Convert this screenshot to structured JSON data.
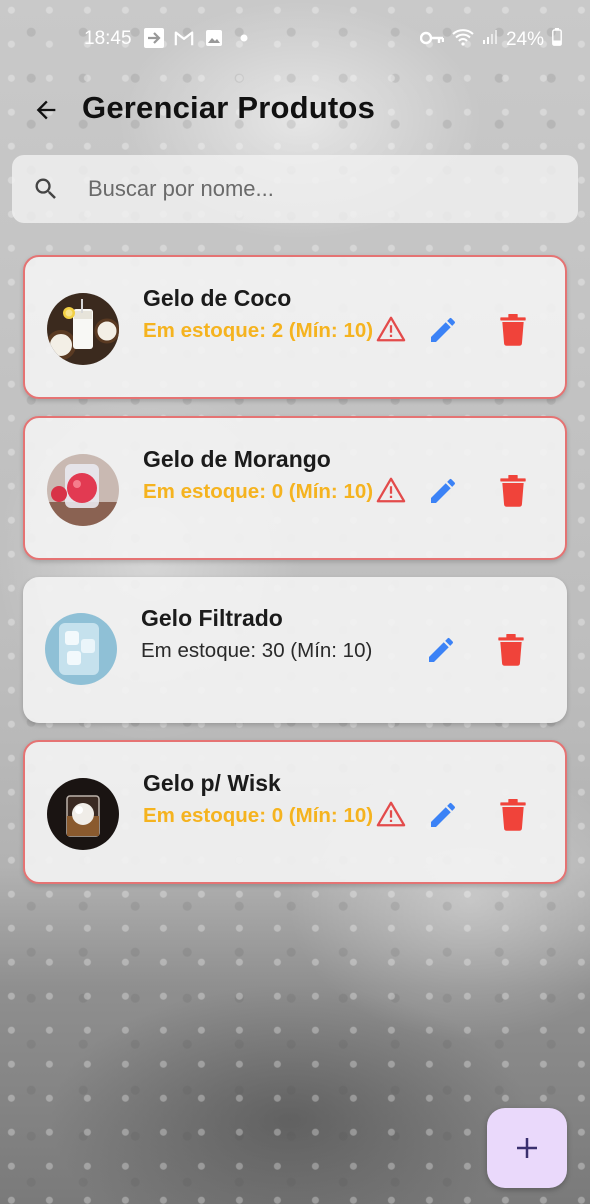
{
  "status_bar": {
    "time": "18:45",
    "battery": "24%",
    "left_icons": [
      "forward-icon",
      "gmail-icon",
      "image-icon",
      "dot-icon"
    ],
    "right_icons": [
      "key-icon",
      "wifi-icon",
      "signal-icon",
      "battery-icon"
    ]
  },
  "header": {
    "title": "Gerenciar Produtos"
  },
  "search": {
    "placeholder": "Buscar por nome..."
  },
  "colors": {
    "warning_text": "#f5b31f",
    "alert_border": "#e57373",
    "edit_blue": "#3b82f6",
    "delete_red": "#f0433a",
    "fab_bg": "#ead9fb",
    "fab_icon": "#3a2f6e"
  },
  "products": [
    {
      "name": "Gelo de Coco",
      "stock": "Em estoque: 2 (Mín: 10)",
      "low_stock": true,
      "thumb": "coconut-drink-image"
    },
    {
      "name": "Gelo de Morango",
      "stock": "Em estoque: 0 (Mín: 10)",
      "low_stock": true,
      "thumb": "strawberry-drink-image"
    },
    {
      "name": "Gelo Filtrado",
      "stock": "Em estoque: 30 (Mín: 10)",
      "low_stock": false,
      "thumb": "filtered-ice-image"
    },
    {
      "name": "Gelo p/ Wisk",
      "stock": "Em estoque: 0 (Mín: 10)",
      "low_stock": true,
      "thumb": "whisky-ice-image"
    }
  ],
  "fab": {
    "icon": "plus-icon"
  }
}
